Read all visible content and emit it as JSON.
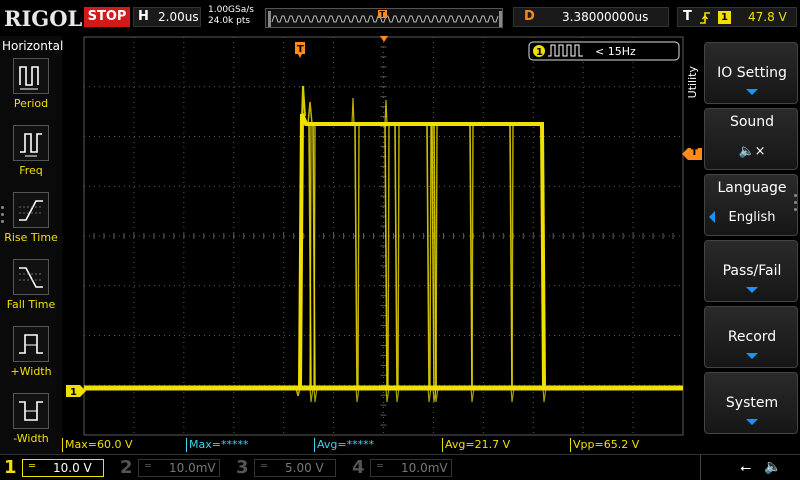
{
  "brand": "RIGOL",
  "top": {
    "run_state": "STOP",
    "horizontal_label": "H",
    "timebase": "2.00us",
    "sample_rate": "1.00GSa/s",
    "memory_depth": "24.0k pts",
    "delay_label": "D",
    "delay_value": "3.38000000us",
    "trigger_label": "T",
    "trigger_channel": "1",
    "trigger_level": "47.8 V"
  },
  "left_panel": {
    "title": "Horizontal",
    "items": [
      {
        "label": "Period",
        "icon": "period-icon"
      },
      {
        "label": "Freq",
        "icon": "frequency-icon"
      },
      {
        "label": "Rise Time",
        "icon": "rise-time-icon"
      },
      {
        "label": "Fall Time",
        "icon": "fall-time-icon"
      },
      {
        "label": "+Width",
        "icon": "positive-width-icon"
      },
      {
        "label": "-Width",
        "icon": "negative-width-icon"
      }
    ]
  },
  "screen": {
    "trigger_marker": "T",
    "channel_marker": "1",
    "trigger_readout_channel": "1",
    "trigger_readout_value": "< 15Hz",
    "waveform_color": "#f0e000",
    "grid_color": "#5a5a5a"
  },
  "right_menu": {
    "section_label": "Utility",
    "trigger_level_marker": "T",
    "buttons": [
      {
        "label": "IO Setting",
        "value": "",
        "arrow": "down"
      },
      {
        "label": "Sound",
        "value": "🔈×",
        "arrow": ""
      },
      {
        "label": "Language",
        "value": "English",
        "arrow": "left"
      },
      {
        "label": "Pass/Fail",
        "value": "",
        "arrow": "down"
      },
      {
        "label": "Record",
        "value": "",
        "arrow": "down"
      },
      {
        "label": "System",
        "value": "",
        "arrow": "down"
      }
    ]
  },
  "measurements": [
    {
      "text": "Max=60.0 V",
      "color": "yellow"
    },
    {
      "text": "Max=*****",
      "color": "cyan"
    },
    {
      "text": "Avg=*****",
      "color": "cyan"
    },
    {
      "text": "Avg=21.7 V",
      "color": "yellow"
    },
    {
      "text": "Vpp=65.2 V",
      "color": "yellow"
    }
  ],
  "channels": [
    {
      "number": "1",
      "coupling": "═",
      "scale": "10.0 V",
      "color": "#f0e000",
      "active": true
    },
    {
      "number": "2",
      "coupling": "═",
      "scale": "10.0mV",
      "color": "#6e6e6e",
      "active": false
    },
    {
      "number": "3",
      "coupling": "═",
      "scale": "5.00 V",
      "color": "#6e6e6e",
      "active": false
    },
    {
      "number": "4",
      "coupling": "═",
      "scale": "10.0mV",
      "color": "#6e6e6e",
      "active": false
    }
  ],
  "status_icons": {
    "usb": "⭠",
    "sound": "🔈"
  }
}
